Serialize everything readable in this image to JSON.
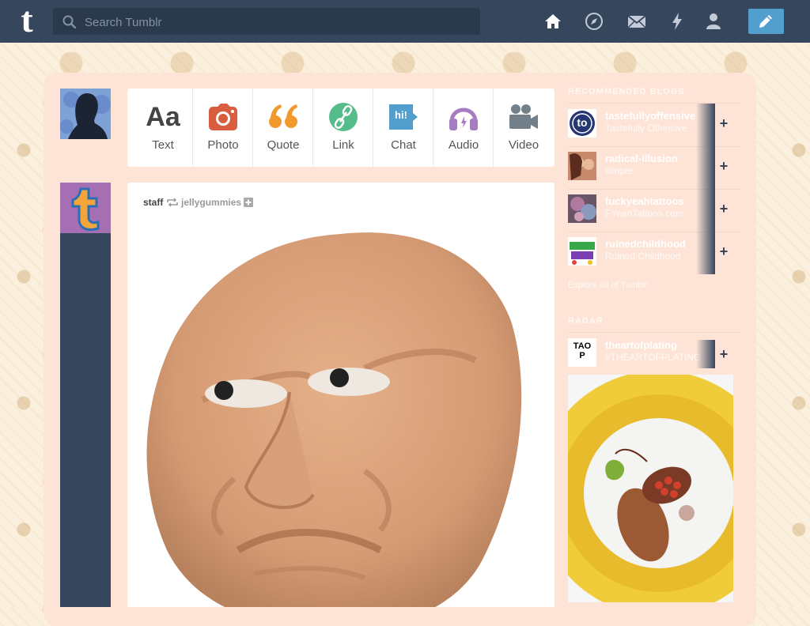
{
  "topbar": {
    "logo_letter": "t",
    "search_placeholder": "Search Tumblr",
    "nav": [
      "home-icon",
      "explore-icon",
      "inbox-icon",
      "activity-icon",
      "account-icon"
    ],
    "compose_icon": "pencil-icon",
    "bg_color": "#36465d",
    "compose_color": "#529ecc"
  },
  "post_types": [
    {
      "label": "Text",
      "glyph": "Aa",
      "color": "#444444"
    },
    {
      "label": "Photo",
      "color": "#d95e40"
    },
    {
      "label": "Quote",
      "glyph": "“",
      "color": "#f2992e"
    },
    {
      "label": "Link",
      "color": "#56bc8a"
    },
    {
      "label": "Chat",
      "glyph": "hi!",
      "color": "#529ecc"
    },
    {
      "label": "Audio",
      "color": "#a77dc2"
    },
    {
      "label": "Video",
      "color": "#748089"
    }
  ],
  "post": {
    "author": "staff",
    "reblogged_from": "jellygummies"
  },
  "sidebar": {
    "recommended_title": "RECOMMENDED BLOGS",
    "blogs": [
      {
        "name": "tastefullyoffensive",
        "title": "Tastefully Offensive",
        "avatar": "to"
      },
      {
        "name": "radical-illusion",
        "title": "simple"
      },
      {
        "name": "fuckyeahtattoos",
        "title": "FYeahTattoos.com"
      },
      {
        "name": "ruinedchildhood",
        "title": "Ruined Childhood"
      }
    ],
    "explore_text": "Explore all of Tumblr",
    "radar_title": "RADAR",
    "radar": {
      "name": "theartofplating",
      "title": "#THEARTOFPLATING",
      "avatar": "TAO P"
    }
  }
}
